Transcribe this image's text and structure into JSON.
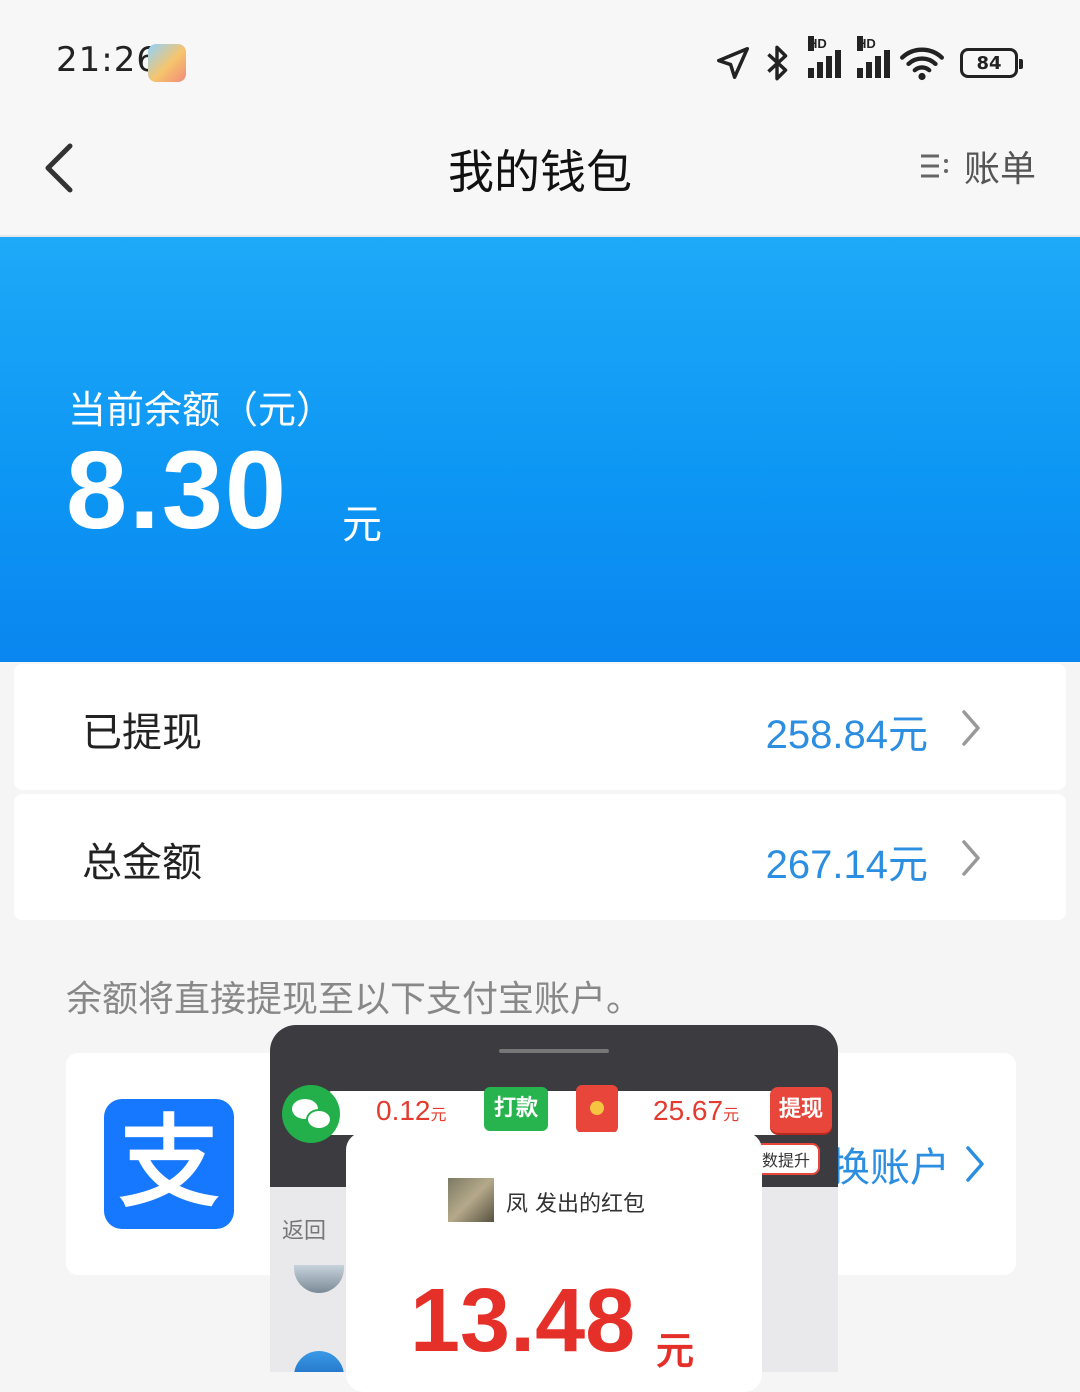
{
  "status_bar": {
    "time": "21:26",
    "battery": "84",
    "icons": [
      "app-avatar-icon",
      "location-icon",
      "bluetooth-icon",
      "signal-hd-icon",
      "signal-hd-icon",
      "wifi-icon",
      "battery-icon"
    ],
    "hd_label": "HD"
  },
  "header": {
    "title": "我的钱包",
    "bill_label": "账单"
  },
  "balance": {
    "label": "当前余额（元）",
    "value": "8.30",
    "unit": "元"
  },
  "rows": [
    {
      "label": "已提现",
      "value": "258.84元"
    },
    {
      "label": "总金额",
      "value": "267.14元"
    }
  ],
  "hint": "余额将直接提现至以下支付宝账户。",
  "alipay": {
    "logo_char": "支",
    "change_label": "换账户"
  },
  "overlay": {
    "amount1": "0.12",
    "amount1_unit": "元",
    "pay_label": "打款",
    "amount2": "25.67",
    "amount2_unit": "元",
    "withdraw_label": "提现",
    "badge": "数提升",
    "back_label": "返回"
  },
  "red_packet": {
    "sender": "凤 发出的红包",
    "amount": "13.48",
    "unit": "元"
  },
  "colors": {
    "banner_top": "#1fa9f8",
    "banner_bottom": "#0a86f0",
    "link_blue": "#2b8ee0",
    "alipay_blue": "#1677ff",
    "red": "#e5302a",
    "green": "#27b44e"
  }
}
